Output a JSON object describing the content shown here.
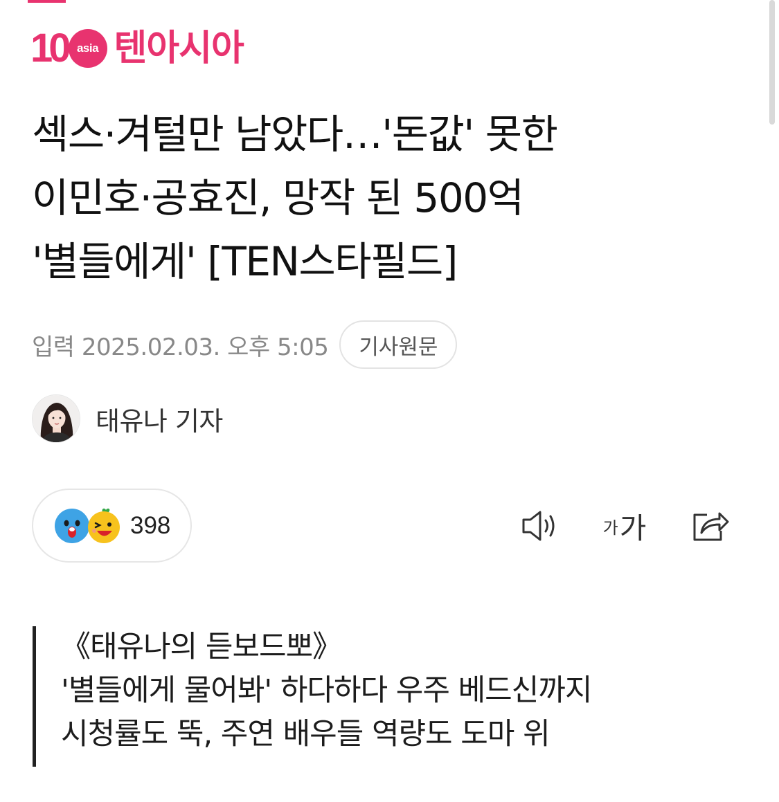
{
  "brand": {
    "logo_number": "10",
    "logo_badge": "asia",
    "name": "텐아시아",
    "color": "#e8336f"
  },
  "article": {
    "headline_lines": [
      "섹스·겨털만 남았다…'돈값' 못한",
      "이민호·공효진, 망작 된 500억",
      "'별들에게' [TEN스타필드]"
    ],
    "published": "입력 2025.02.03. 오후 5:05",
    "origin_button": "기사원문",
    "author": "태유나 기자",
    "reaction_count": "398",
    "summary_lines": [
      "《태유나의 듣보드뽀》",
      "'별들에게 물어봐' 하다하다 우주 베드신까지",
      "시청률도 뚝, 주연 배우들 역량도 도마 위"
    ]
  },
  "toolbar": {
    "font_small": "가",
    "font_large": "가"
  },
  "icons": {
    "reaction_1": "surprised-face-icon",
    "reaction_2": "excited-face-icon",
    "audio": "speaker-icon",
    "share": "share-icon"
  }
}
